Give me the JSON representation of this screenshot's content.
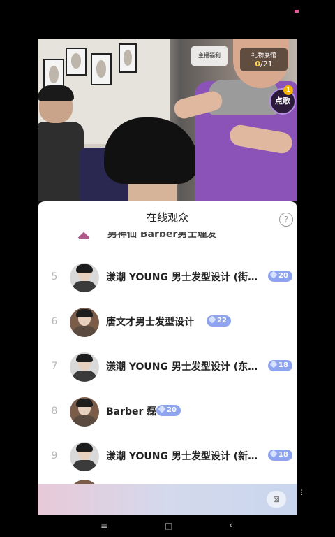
{
  "video": {
    "gift_display": {
      "title": "礼物展馆",
      "current": "0",
      "total": "/21"
    },
    "bubble_text": "主播福利",
    "song_button": "点歌",
    "song_badge": "1"
  },
  "panel": {
    "title": "在线观众",
    "help_label": "?",
    "partial_top_text": "男神仙 Barber男士理发",
    "rows": [
      {
        "rank": "5",
        "name": "漾潮 YOUNG 男士发型设计 (街…",
        "level": "20"
      },
      {
        "rank": "6",
        "name": "唐文才男士发型设计",
        "level": "22"
      },
      {
        "rank": "7",
        "name": "漾潮 YOUNG 男士发型设计 (东…",
        "level": "18"
      },
      {
        "rank": "8",
        "name": "Barber 磊",
        "level": "20"
      },
      {
        "rank": "9",
        "name": "漾潮 YOUNG 男士发型设计 (新…",
        "level": "18"
      }
    ]
  },
  "bottom_bar": {
    "button_icon": "gift-toggle-icon"
  },
  "nav": {
    "menu": "≡",
    "home": "□",
    "back": "‹"
  },
  "colors": {
    "badge": "#8fa4ee",
    "apron": "#8b52b8"
  }
}
